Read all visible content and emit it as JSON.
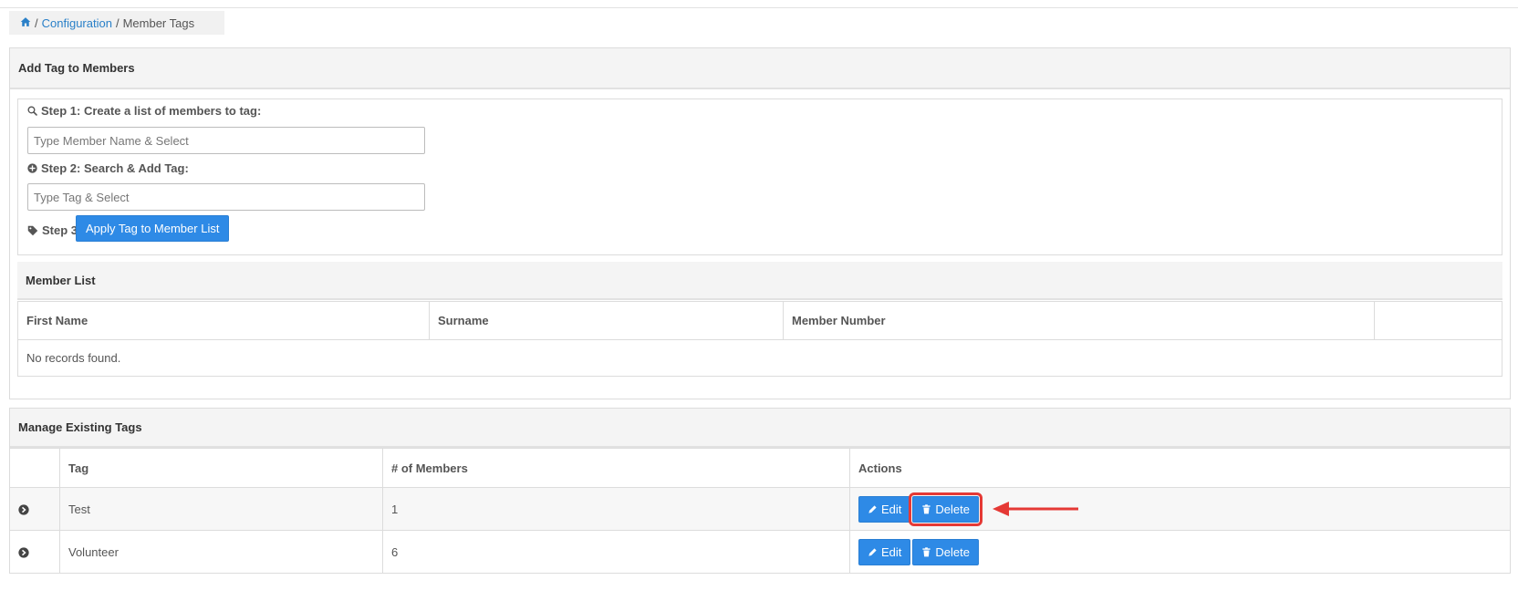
{
  "breadcrumb": {
    "home_icon": "home-icon",
    "separator": "/",
    "configuration": "Configuration",
    "current": "Member Tags"
  },
  "add_panel": {
    "title": "Add Tag to Members",
    "step1": {
      "icon": "search-icon",
      "label": "Step 1: Create a list of members to tag:",
      "placeholder": "Type Member Name & Select",
      "value": ""
    },
    "step2": {
      "icon": "plus-circle-icon",
      "label": "Step 2: Search & Add Tag:",
      "placeholder": "Type Tag & Select",
      "value": ""
    },
    "step3": {
      "icon": "tag-icon",
      "label": "Step 3:",
      "button": "Apply Tag to Member List"
    }
  },
  "member_list": {
    "title": "Member List",
    "columns": [
      "First Name",
      "Surname",
      "Member Number",
      ""
    ],
    "empty_text": "No records found."
  },
  "manage_panel": {
    "title": "Manage Existing Tags",
    "columns": [
      "",
      "Tag",
      "# of Members",
      "Actions"
    ],
    "rows": [
      {
        "tag": "Test",
        "members": "1",
        "edit": "Edit",
        "delete": "Delete",
        "highlighted_delete": true
      },
      {
        "tag": "Volunteer",
        "members": "6",
        "edit": "Edit",
        "delete": "Delete",
        "highlighted_delete": false
      }
    ]
  },
  "colors": {
    "primary": "#2e8ae6",
    "link": "#2a80c8",
    "highlight": "#e53935"
  }
}
